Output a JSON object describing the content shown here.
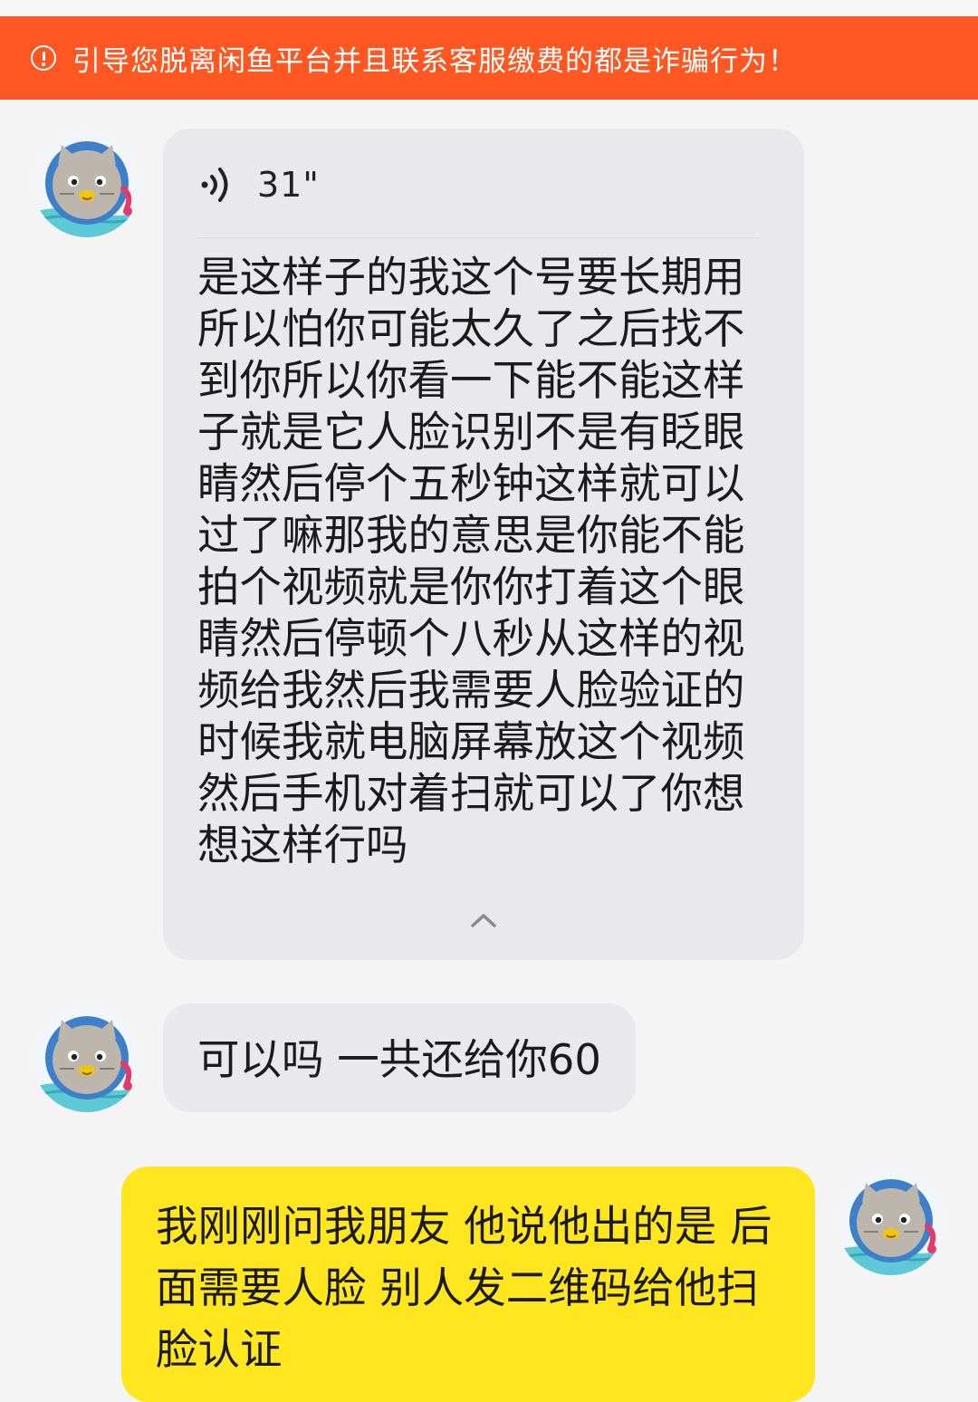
{
  "banner": {
    "warning_text": "引导您脱离闲鱼平台并且联系客服缴费的都是诈骗行为！",
    "color": "#ff5722"
  },
  "messages": [
    {
      "side": "left",
      "kind": "voice",
      "duration": "31\"",
      "transcript": "是这样子的我这个号要长期用所以怕你可能太久了之后找不到你所以你看一下能不能这样子就是它人脸识别不是有眨眼睛然后停个五秒钟这样就可以过了嘛那我的意思是你能不能拍个视频就是你你打着这个眼睛然后停顿个八秒从这样的视频给我然后我需要人脸验证的时候我就电脑屏幕放这个视频然后手机对着扫就可以了你想想这样行吗",
      "icons": [
        "voice-wave-icon",
        "chevron-up-icon"
      ]
    },
    {
      "side": "left",
      "kind": "text",
      "text": "可以吗 一共还给你60"
    },
    {
      "side": "right",
      "kind": "text",
      "text": "我刚刚问我朋友 他说他出的是 后面需要人脸 别人发二维码给他扫脸认证"
    }
  ],
  "colors": {
    "incoming_bubble": "#e9e9ec",
    "outgoing_bubble": "#ffe61e",
    "background": "#f4f4f4"
  }
}
